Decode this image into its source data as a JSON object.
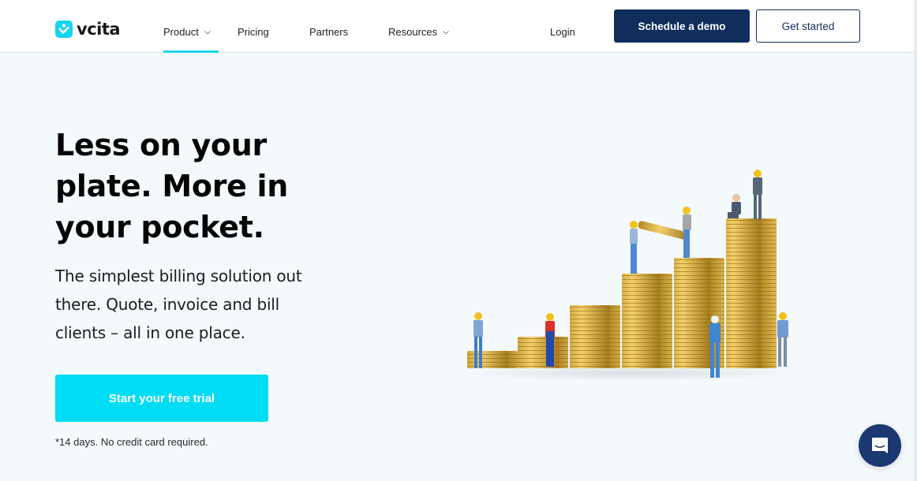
{
  "header": {
    "logo_text": "vcita",
    "nav": [
      {
        "label": "Product",
        "has_dropdown": true,
        "active": true
      },
      {
        "label": "Pricing",
        "has_dropdown": false
      },
      {
        "label": "Partners",
        "has_dropdown": false
      },
      {
        "label": "Resources",
        "has_dropdown": true
      }
    ],
    "login_label": "Login",
    "schedule_demo_label": "Schedule a demo",
    "get_started_label": "Get started"
  },
  "hero": {
    "title_lines": [
      "Less on your",
      "plate. More in",
      "your pocket."
    ],
    "subtitle_lines": [
      "The simplest billing solution out",
      "there. Quote, invoice and bill",
      "clients – all in one place."
    ],
    "cta_label": "Start your free trial",
    "note": "*14 days. No credit card required.",
    "illustration_alt": "miniature workers building stacks of gold coins"
  },
  "chat": {
    "icon": "chat-bubble-icon"
  },
  "colors": {
    "accent": "#00dcf4",
    "brand_navy": "#0f2e5c",
    "chat_navy": "#1c3872",
    "hero_bg": "#f4f9fc"
  }
}
